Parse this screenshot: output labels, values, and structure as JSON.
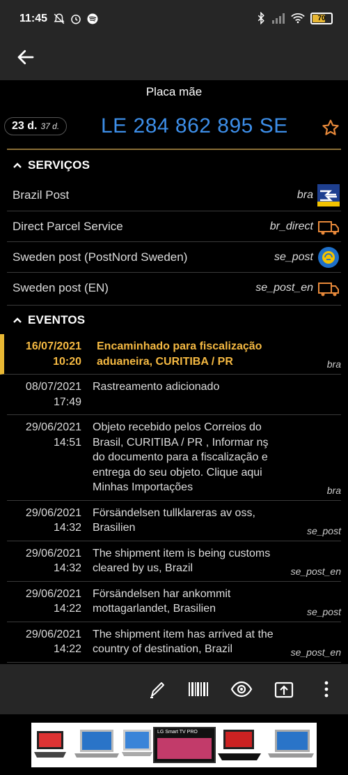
{
  "status_bar": {
    "time": "11:45",
    "battery": "70",
    "left_icons": [
      "silent-bell-icon",
      "alarm-icon",
      "spotify-icon"
    ],
    "right_icons": [
      "bluetooth-icon",
      "signal-icon",
      "wifi-icon",
      "battery-icon"
    ]
  },
  "parcel": {
    "title": "Placa mãe",
    "days": "23 d.",
    "days_total": "37 d.",
    "tracking_number": "LE 284 862 895 SE"
  },
  "services": {
    "header": "SERVIÇOS",
    "items": [
      {
        "name": "Brazil Post",
        "code": "bra",
        "icon": "correios-logo"
      },
      {
        "name": "Direct Parcel Service",
        "code": "br_direct",
        "icon": "truck-icon"
      },
      {
        "name": "Sweden post (PostNord Sweden)",
        "code": "se_post",
        "icon": "postnord-logo"
      },
      {
        "name": "Sweden post (EN)",
        "code": "se_post_en",
        "icon": "truck-icon"
      }
    ]
  },
  "events": {
    "header": "EVENTOS",
    "items": [
      {
        "date": "16/07/2021",
        "time": "10:20",
        "text": "Encaminhado para fiscalização aduaneira, CURITIBA / PR",
        "source": "bra",
        "highlight": true
      },
      {
        "date": "08/07/2021",
        "time": "17:49",
        "text": "Rastreamento adicionado",
        "source": "",
        "highlight": false
      },
      {
        "date": "29/06/2021",
        "time": "14:51",
        "text": "Objeto recebido pelos Correios do Brasil, CURITIBA / PR , Informar nş do documento para a fiscalização e entrega do seu objeto. Clique aqui Minhas Importações",
        "source": "bra",
        "highlight": false
      },
      {
        "date": "29/06/2021",
        "time": "14:32",
        "text": "Försändelsen tullklareras av oss, Brasilien",
        "source": "se_post",
        "highlight": false
      },
      {
        "date": "29/06/2021",
        "time": "14:32",
        "text": "The shipment item is being customs cleared by us, Brazil",
        "source": "se_post_en",
        "highlight": false
      },
      {
        "date": "29/06/2021",
        "time": "14:22",
        "text": "Försändelsen har ankommit mottagarlandet, Brasilien",
        "source": "se_post",
        "highlight": false
      },
      {
        "date": "29/06/2021",
        "time": "14:22",
        "text": "The shipment item has arrived at the country of destination, Brazil",
        "source": "se_post_en",
        "highlight": false
      }
    ]
  },
  "toolbar": {
    "buttons": [
      "edit-icon",
      "barcode-icon",
      "visibility-icon",
      "share-icon",
      "more-icon"
    ]
  },
  "ad": {
    "label": "LG Smart TV PRO"
  },
  "colors": {
    "accent": "#e8b733",
    "tracking": "#3d8ee8",
    "bar": "#262626"
  }
}
